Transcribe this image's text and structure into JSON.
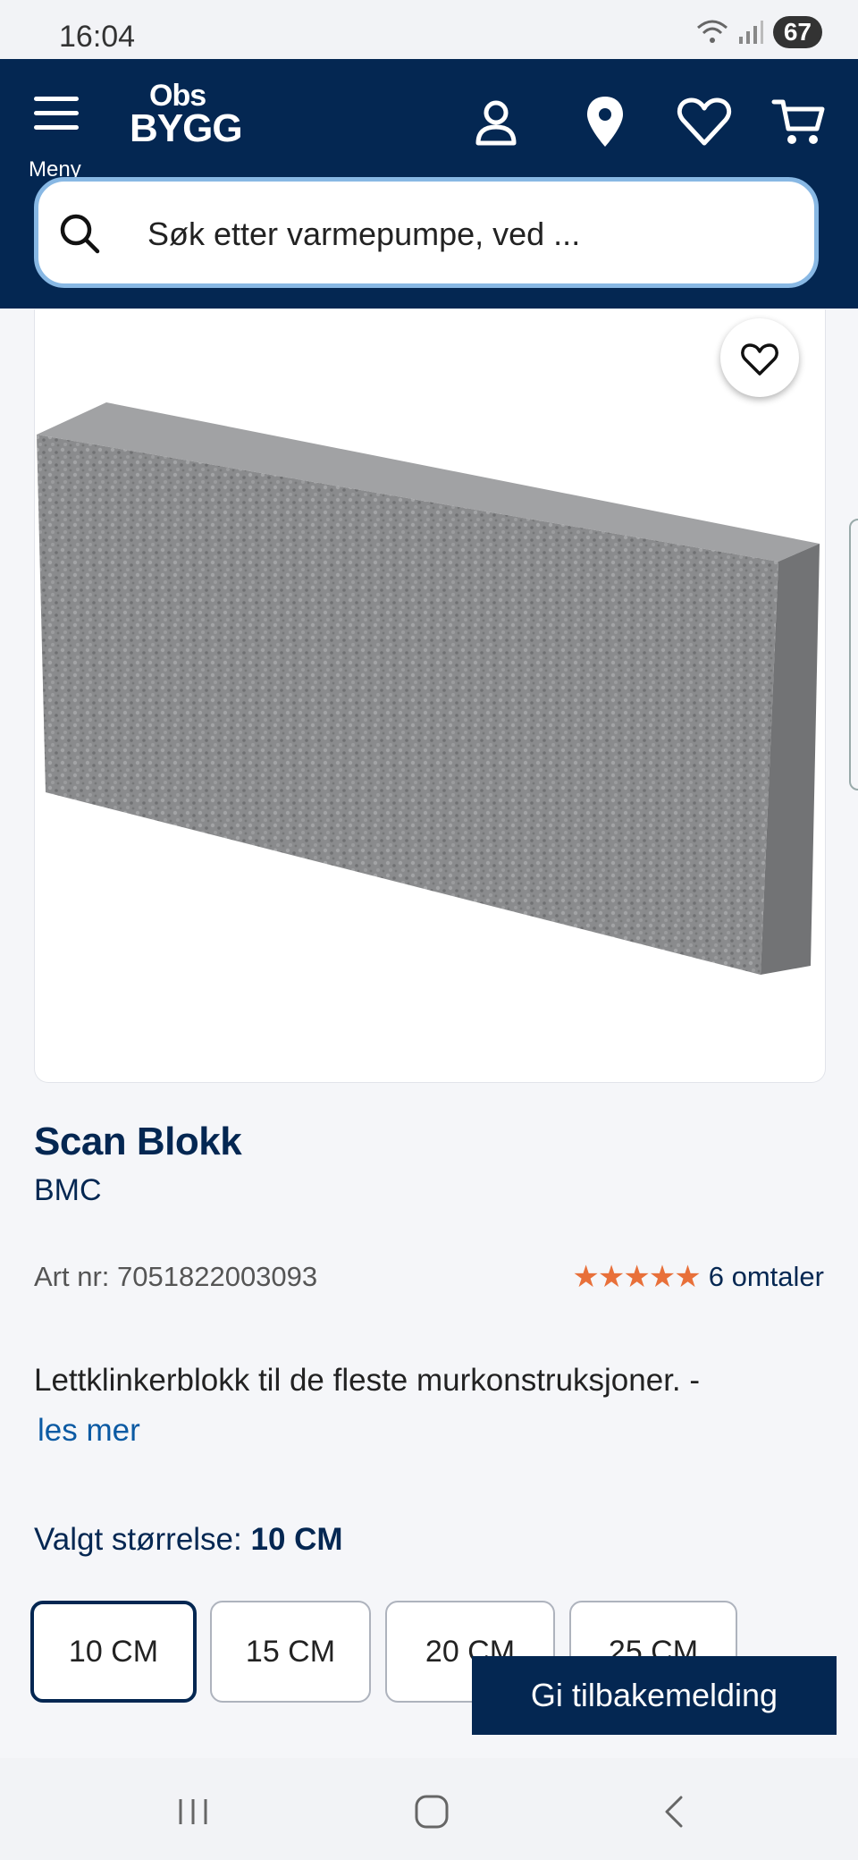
{
  "status_bar": {
    "time": "16:04",
    "battery": "67"
  },
  "header": {
    "menu_label": "Meny",
    "logo_line1": "Obs",
    "logo_line2": "BYGG",
    "search_placeholder": "Søk etter varmepumpe, ved ...",
    "icons": [
      "account-icon",
      "location-pin-icon",
      "heart-icon",
      "cart-icon"
    ]
  },
  "product": {
    "title": "Scan Blokk",
    "brand": "BMC",
    "art_nr": "Art nr: 7051822003093",
    "rating_stars": "★★★★★",
    "rating_value": 5,
    "reviews": "6 omtaler",
    "description": "Lettklinkerblokk til de fleste murkonstruksjoner. -",
    "read_more": "les mer",
    "size_label": "Valgt størrelse: ",
    "size_selected": "10 CM",
    "sizes": [
      "10 CM",
      "15 CM",
      "20 CM",
      "25 CM"
    ]
  },
  "feedback_button": "Gi tilbakemelding",
  "colors": {
    "brand_navy": "#042752",
    "star_orange": "#e8703a",
    "link_blue": "#0b5aa3",
    "search_border": "#88b8e4"
  }
}
